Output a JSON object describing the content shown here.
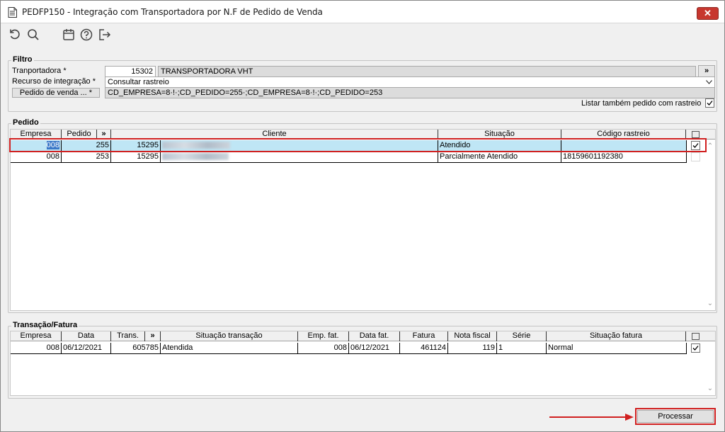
{
  "window": {
    "title": "PEDFP150 - Integração com Transportadora por N.F de Pedido de Venda",
    "close_glyph": "✕"
  },
  "toolbar": {
    "icons": [
      "refresh-icon",
      "search-icon",
      "calendar-icon",
      "help-icon",
      "exit-icon"
    ]
  },
  "filtro": {
    "title": "Filtro",
    "transportadora_label": "Tranportadora *",
    "transportadora_code": "15302",
    "transportadora_name": "TRANSPORTADORA VHT",
    "lookup_button": "»",
    "recurso_label": "Recurso de integração *",
    "recurso_value": "Consultar rastreio",
    "pedido_button": "Pedido de venda ... *",
    "pedido_value": "CD_EMPRESA=8·!·;CD_PEDIDO=255·;CD_EMPRESA=8·!·;CD_PEDIDO=253",
    "listar_label": "Listar também pedido com rastreio",
    "listar_checked": true
  },
  "pedido": {
    "title": "Pedido",
    "columns": [
      "Empresa",
      "Pedido",
      "»",
      "Cliente",
      "Situação",
      "Código rastreio"
    ],
    "rows": [
      {
        "empresa": "008",
        "pedido": "255",
        "cod": "15295",
        "situacao": "Atendido",
        "rastreio": "",
        "checked": true
      },
      {
        "empresa": "008",
        "pedido": "253",
        "cod": "15295",
        "situacao": "Parcialmente Atendido",
        "rastreio": "18159601192380",
        "checked": false
      }
    ]
  },
  "transacao": {
    "title": "Transação/Fatura",
    "columns": [
      "Empresa",
      "Data",
      "Trans.",
      "»",
      "Situação transação",
      "Emp. fat.",
      "Data fat.",
      "Fatura",
      "Nota fiscal",
      "Série",
      "Situação fatura"
    ],
    "rows": [
      {
        "empresa": "008",
        "data": "06/12/2021",
        "trans": "605785",
        "situacao": "Atendida",
        "emp_fat": "008",
        "data_fat": "06/12/2021",
        "fatura": "461124",
        "nota": "119",
        "serie": "1",
        "sit_fatura": "Normal",
        "checked": true
      }
    ]
  },
  "footer": {
    "processar_label": "Processar"
  },
  "colors": {
    "selection": "#bfe6f5",
    "annotation": "#d02020"
  }
}
